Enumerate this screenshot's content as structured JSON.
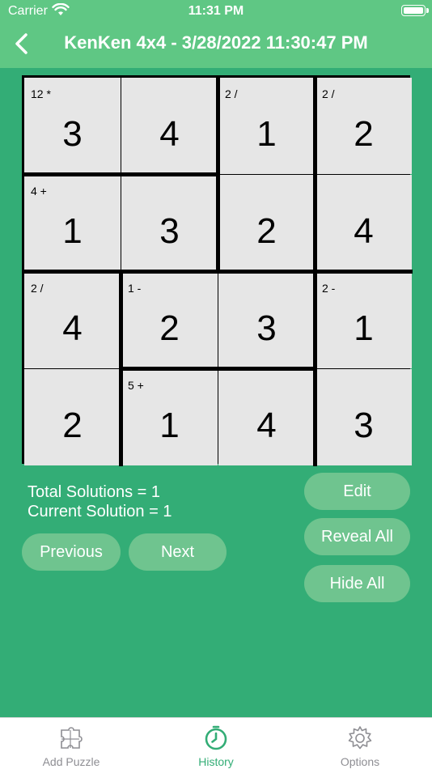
{
  "status": {
    "carrier": "Carrier",
    "time": "11:31 PM"
  },
  "header": {
    "title": "KenKen  4x4 - 3/28/2022 11:30:47 PM"
  },
  "grid": {
    "cells": [
      {
        "label": "12 *",
        "value": "3"
      },
      {
        "label": "",
        "value": "4"
      },
      {
        "label": "2 /",
        "value": "1"
      },
      {
        "label": "2 /",
        "value": "2"
      },
      {
        "label": "4 +",
        "value": "1"
      },
      {
        "label": "",
        "value": "3"
      },
      {
        "label": "",
        "value": "2"
      },
      {
        "label": "",
        "value": "4"
      },
      {
        "label": "2 /",
        "value": "4"
      },
      {
        "label": "1 -",
        "value": "2"
      },
      {
        "label": "",
        "value": "3"
      },
      {
        "label": "2 -",
        "value": "1"
      },
      {
        "label": "",
        "value": "2"
      },
      {
        "label": "5 +",
        "value": "1"
      },
      {
        "label": "",
        "value": "4"
      },
      {
        "label": "",
        "value": "3"
      }
    ]
  },
  "info": {
    "total_solutions": "Total Solutions = 1",
    "current_solution": "Current Solution = 1"
  },
  "buttons": {
    "edit": "Edit",
    "reveal_all": "Reveal All",
    "hide_all": "Hide All",
    "previous": "Previous",
    "next": "Next"
  },
  "tabs": [
    {
      "label": "Add Puzzle",
      "icon": "puzzle-icon",
      "color": "#8e8e93"
    },
    {
      "label": "History",
      "icon": "history-clock-icon",
      "color": "#33ad76"
    },
    {
      "label": "Options",
      "icon": "gear-icon",
      "color": "#8e8e93"
    }
  ],
  "colors": {
    "background": "#33ad76",
    "header": "#5fc784",
    "cell": "#e6e6e6",
    "button": "#6fc48f"
  }
}
